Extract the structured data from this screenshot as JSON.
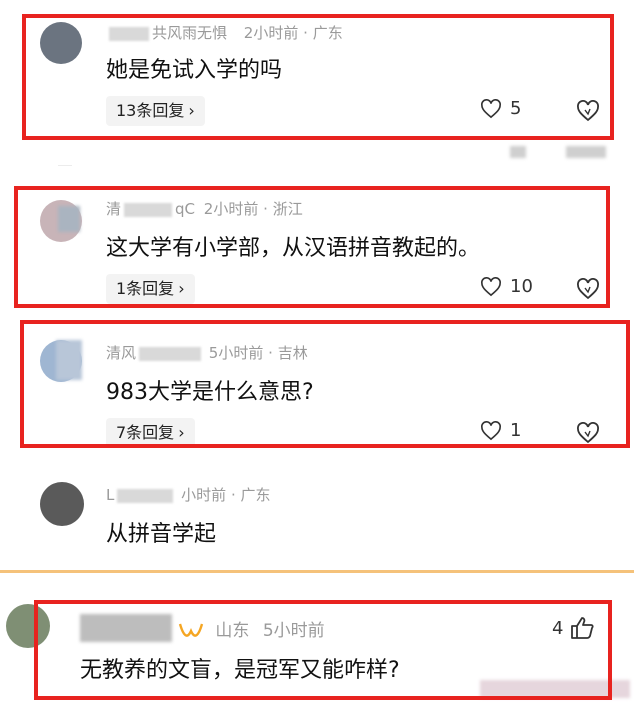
{
  "comments": [
    {
      "meta_user": "共风雨无惧",
      "meta_time": "2小时前",
      "meta_region": "广东",
      "text": "她是免试入学的吗",
      "reply_label": "13条回复",
      "likes": "5"
    },
    {
      "meta_user_prefix": "清",
      "meta_user_suffix": "qC",
      "meta_time": "2小时前",
      "meta_region": "浙江",
      "text": "这大学有小学部，从汉语拼音教起的。",
      "reply_label": "1条回复",
      "likes": "10"
    },
    {
      "meta_user_prefix": "清风",
      "meta_time": "5小时前",
      "meta_region": "吉林",
      "text": "983大学是什么意思?",
      "reply_label": "7条回复",
      "likes": "1"
    },
    {
      "meta_user_prefix": "L",
      "meta_time": "小时前",
      "meta_region": "广东",
      "text": "从拼音学起"
    },
    {
      "meta_region": "山东",
      "meta_time": "5小时前",
      "text": "无教养的文盲，是冠军又能咋样?",
      "likes": "4"
    }
  ],
  "separator": "·",
  "chevron": "›",
  "colors": {
    "highlight": "#e8231f",
    "accent": "#f5a623"
  }
}
